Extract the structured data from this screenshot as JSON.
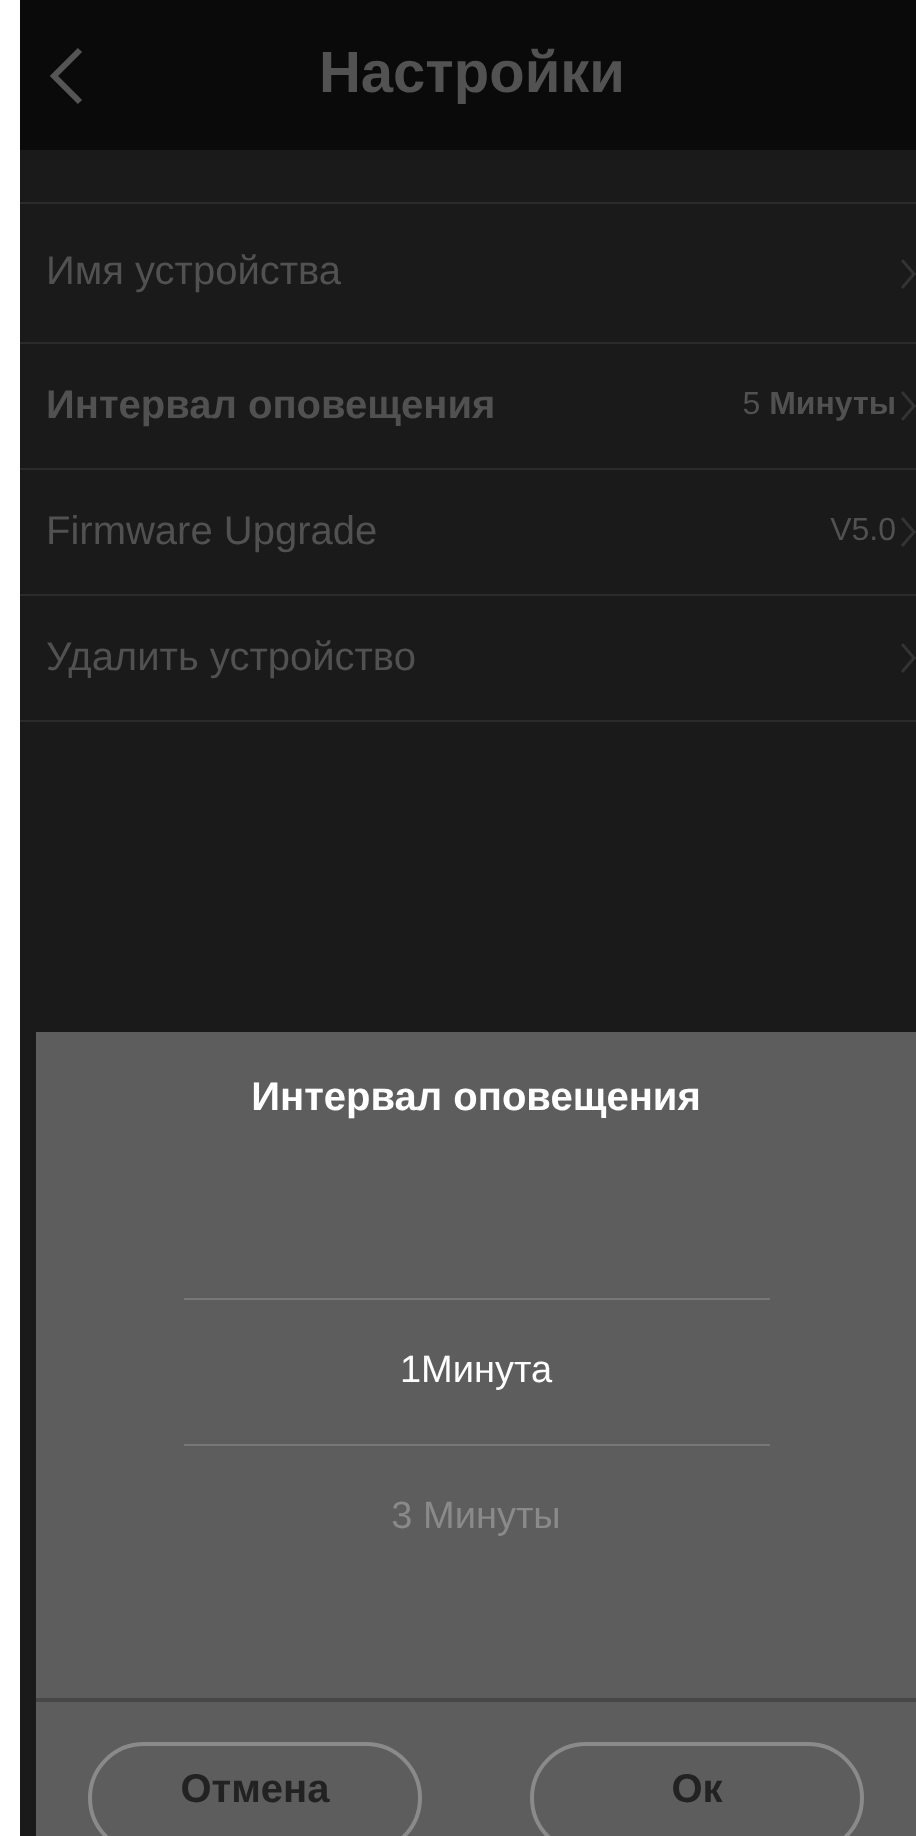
{
  "header": {
    "title": "Настройки"
  },
  "settings": [
    {
      "label": "Имя устройства",
      "selected": false
    },
    {
      "label": "Интервал оповещения",
      "value": "5 **Минуты**",
      "selected": true
    },
    {
      "label": "Firmware Upgrade",
      "value": "V5.0",
      "selected": false
    },
    {
      "label": "Удалить устройство",
      "selected": false
    }
  ],
  "dialog": {
    "title": "Интервал оповещения",
    "options": [
      {
        "label": "1Минута",
        "selected": true
      },
      {
        "label": "3 Минуты",
        "selected": false
      }
    ],
    "buttons": [
      "Отмена",
      "Ок"
    ]
  }
}
